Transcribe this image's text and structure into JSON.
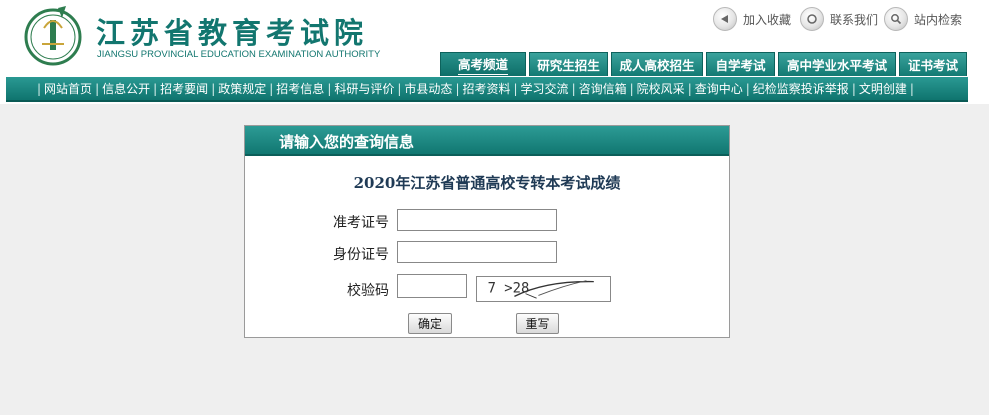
{
  "header": {
    "title_cn": "江苏省教育考试院",
    "title_en": "JIANGSU PROVINCIAL EDUCATION EXAMINATION AUTHORITY",
    "logo_icon": "emblem-icon",
    "utilities": [
      {
        "label": "加入收藏",
        "icon": "bookmark-icon"
      },
      {
        "label": "联系我们",
        "icon": "contact-icon"
      },
      {
        "label": "站内检索",
        "icon": "search-icon"
      }
    ]
  },
  "tabs": [
    {
      "label": "高考频道",
      "active": true
    },
    {
      "label": "研究生招生"
    },
    {
      "label": "成人高校招生"
    },
    {
      "label": "自学考试"
    },
    {
      "label": "高中学业水平考试"
    },
    {
      "label": "证书考试"
    }
  ],
  "nav": {
    "items": [
      "网站首页",
      "信息公开",
      "招考要闻",
      "政策规定",
      "招考信息",
      "科研与评价",
      "市县动态",
      "招考资料",
      "学习交流",
      "咨询信箱",
      "院校风采",
      "查询中心",
      "纪检监察投诉举报",
      "文明创建"
    ]
  },
  "panel": {
    "title": "请输入您的查询信息",
    "exam_title": "2020年江苏省普通高校专转本考试成绩",
    "fields": {
      "ticket_label": "准考证号",
      "ticket_value": "",
      "id_label": "身份证号",
      "id_value": "",
      "code_label": "校验码",
      "code_value": ""
    },
    "captcha_text": "7 >28",
    "submit_label": "确定",
    "reset_label": "重写"
  },
  "colors": {
    "brand_teal": "#12766f",
    "page_bg": "#efefef"
  }
}
